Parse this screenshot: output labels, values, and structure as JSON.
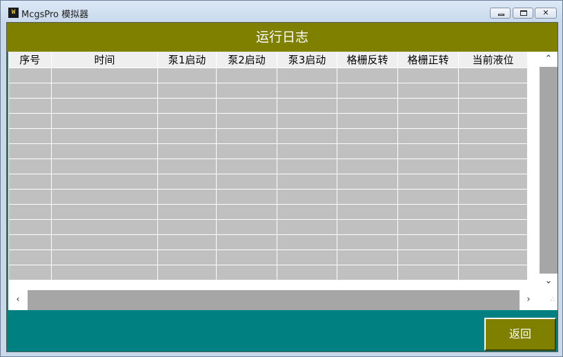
{
  "window": {
    "title": "McgsPro 模拟器",
    "icon": "mcgs-app-icon",
    "controls": {
      "minimize": "minimize-icon",
      "maximize": "maximize-icon",
      "close": "close-icon"
    }
  },
  "header": {
    "title": "运行日志",
    "color": "#808000"
  },
  "log_table": {
    "columns": [
      "序号",
      "时间",
      "泵1启动",
      "泵2启动",
      "泵3启动",
      "格栅反转",
      "格栅正转",
      "当前液位"
    ],
    "visible_empty_rows": 14,
    "cell_color": "#c0c0c0",
    "header_color": "#efefef"
  },
  "scrollbars": {
    "up_arrow": "chevron-up-icon",
    "down_arrow": "chevron-down-icon",
    "left_arrow": "chevron-left-icon",
    "right_arrow": "chevron-right-icon",
    "grip": "resize-grip-icon"
  },
  "footer": {
    "return_label": "返回",
    "background": "#008080",
    "button_color": "#808000"
  }
}
